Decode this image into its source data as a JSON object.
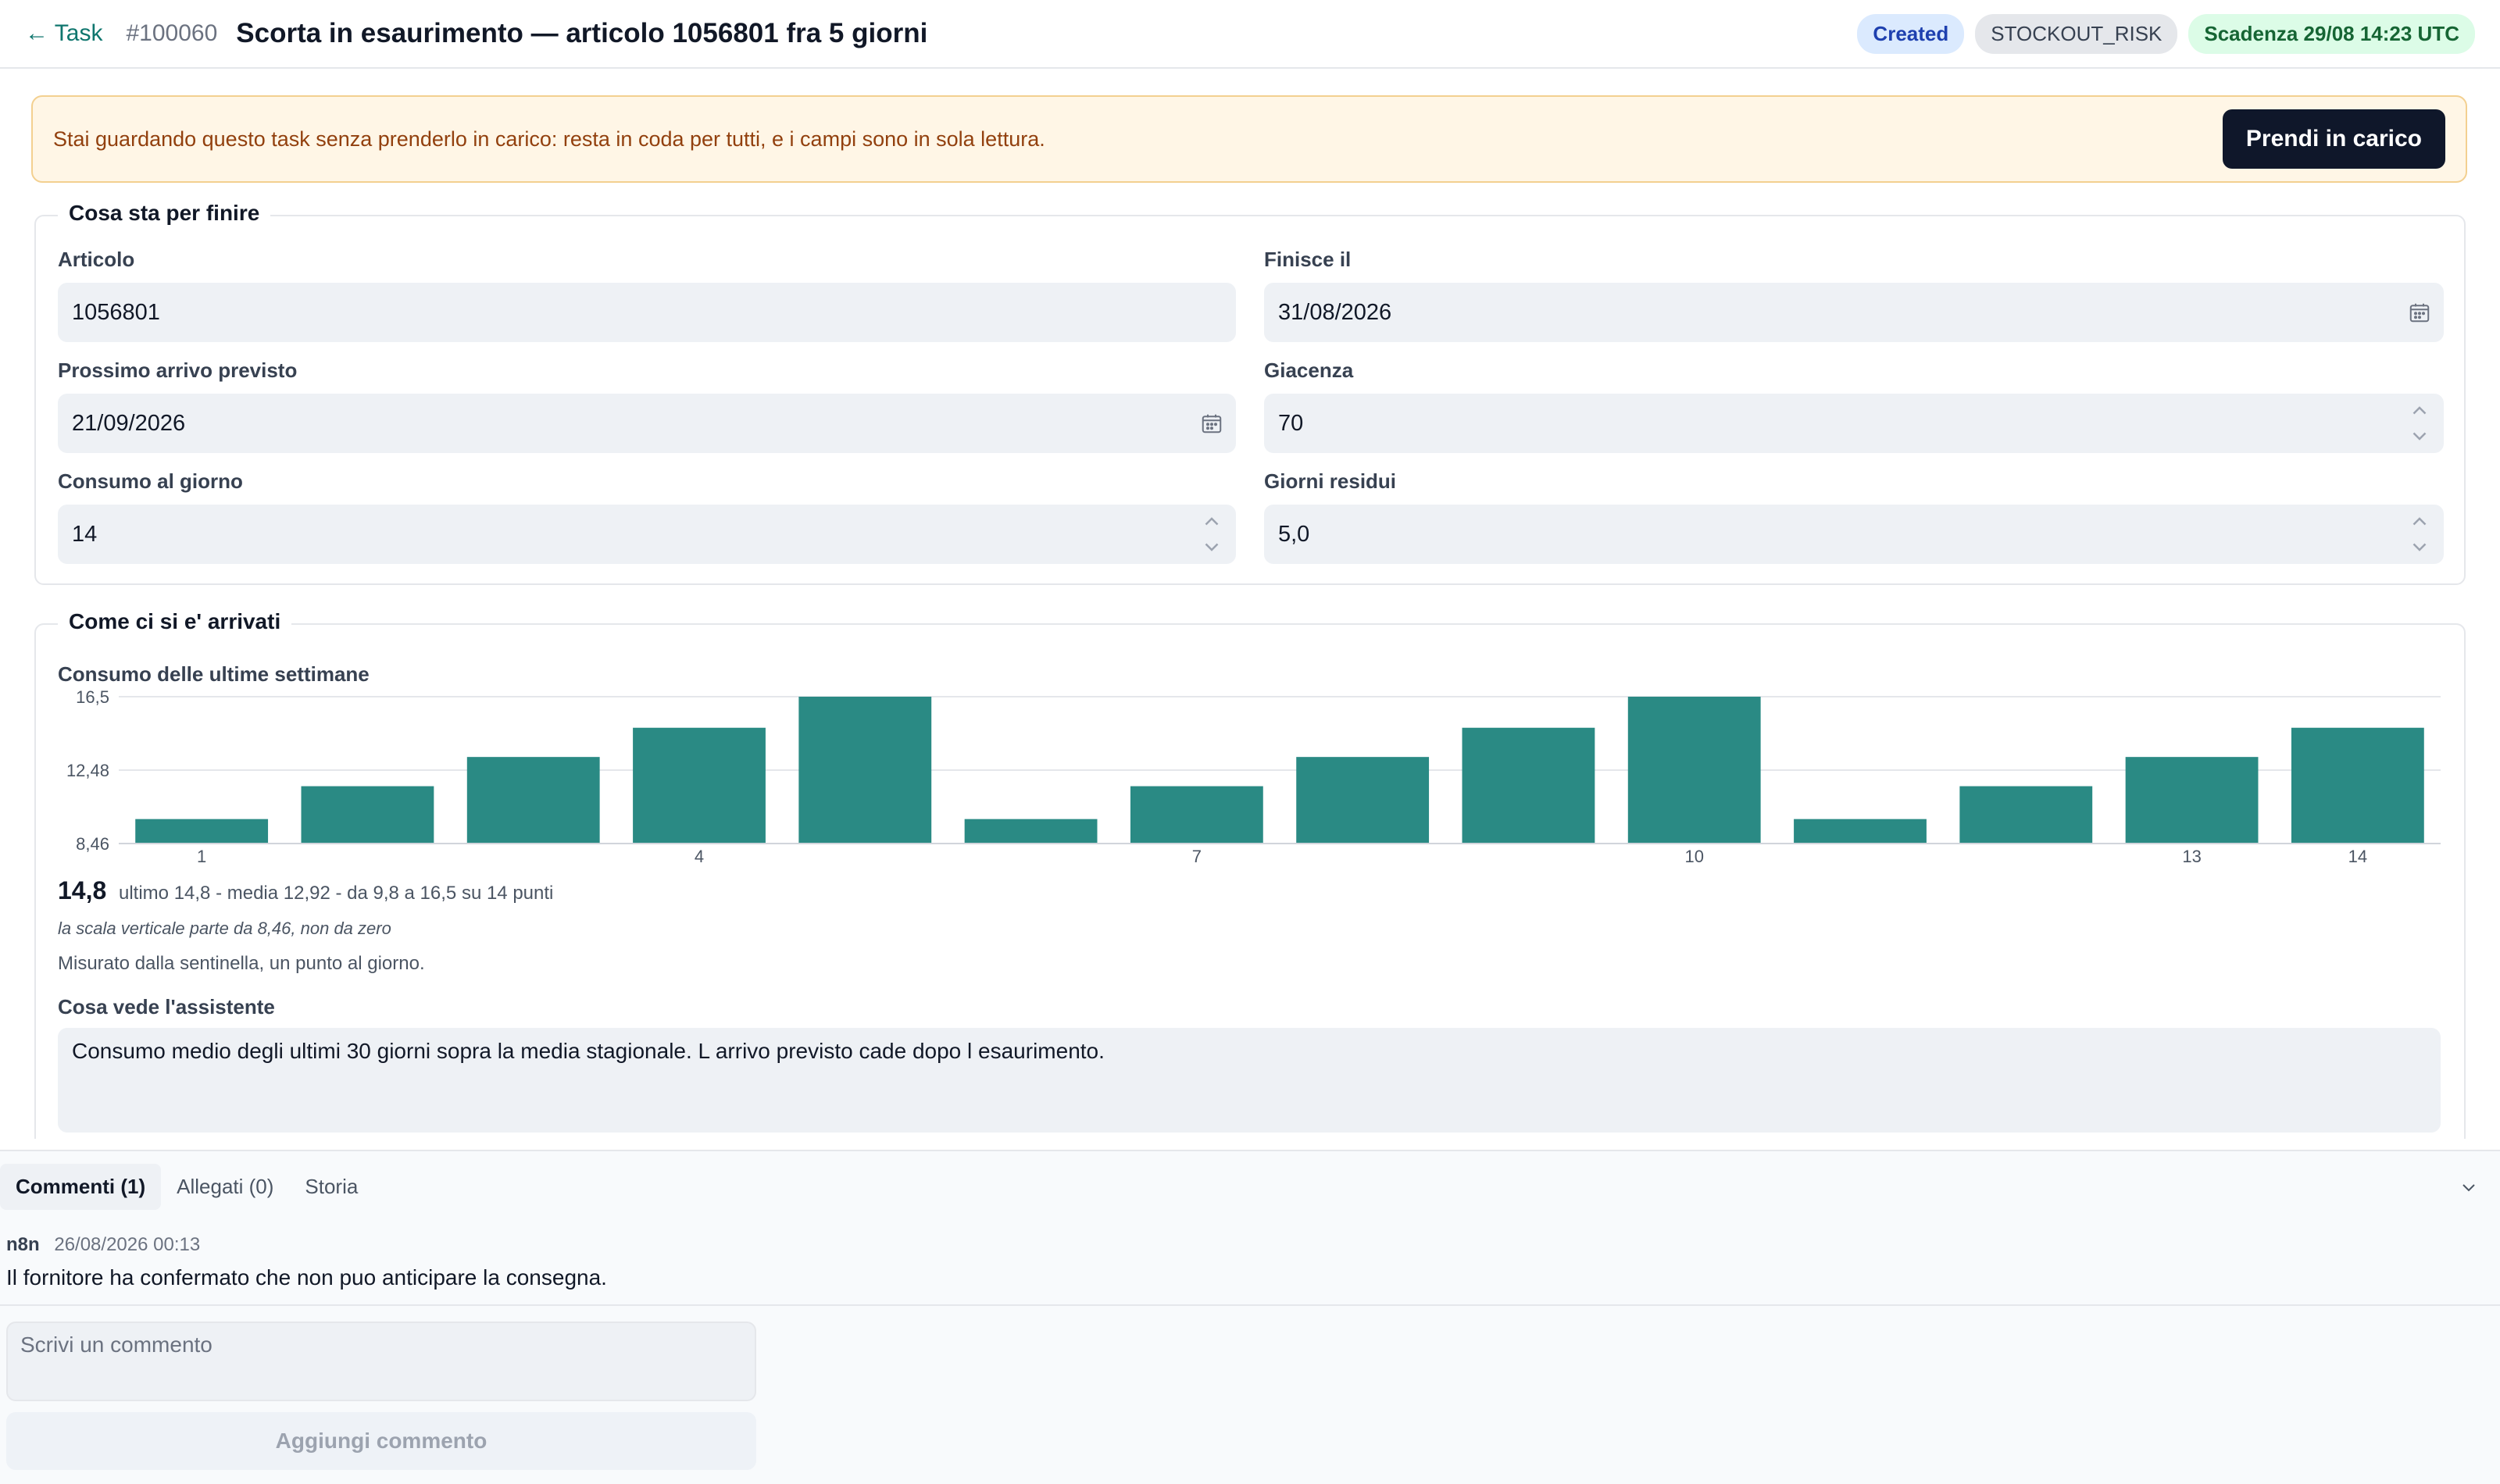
{
  "header": {
    "back_label": "← Task",
    "task_id": "#100060",
    "title": "Scorta in esaurimento — articolo 1056801 fra 5 giorni",
    "badges": {
      "status": "Created",
      "type": "STOCKOUT_RISK",
      "due": "Scadenza 29/08 14:23 UTC"
    }
  },
  "banner": {
    "text": "Stai guardando questo task senza prenderlo in carico: resta in coda per tutti, e i campi sono in sola lettura.",
    "button_label": "Prendi in carico"
  },
  "section_what": {
    "title": "Cosa sta per finire",
    "fields": {
      "articolo": {
        "label": "Articolo",
        "value": "1056801"
      },
      "finisce_il": {
        "label": "Finisce il",
        "value": "31/08/2026"
      },
      "prossimo_arrivo": {
        "label": "Prossimo arrivo previsto",
        "value": "21/09/2026"
      },
      "giacenza": {
        "label": "Giacenza",
        "value": "70"
      },
      "consumo": {
        "label": "Consumo al giorno",
        "value": "14"
      },
      "giorni_residui": {
        "label": "Giorni residui",
        "value": "5,0"
      }
    }
  },
  "section_how": {
    "title": "Come ci si e' arrivati",
    "chart_label": "Consumo delle ultime settimane",
    "big_value": "14,8",
    "stats": "ultimo 14,8 - media 12,92 - da 9,8 a 16,5 su 14 punti",
    "scale_note": "la scala verticale parte da 8,46, non da zero",
    "measure_note": "Misurato dalla sentinella, un punto al giorno.",
    "assistant_label": "Cosa vede l'assistente",
    "assistant_text": "Consumo medio degli ultimi 30 giorni sopra la media stagionale. L arrivo previsto cade dopo l esaurimento."
  },
  "chart_data": {
    "type": "bar",
    "categories": [
      1,
      2,
      3,
      4,
      5,
      6,
      7,
      8,
      9,
      10,
      11,
      12,
      13,
      14
    ],
    "values": [
      9.8,
      11.6,
      13.2,
      14.8,
      16.5,
      9.8,
      11.6,
      13.2,
      14.8,
      16.5,
      9.8,
      11.6,
      13.2,
      14.8
    ],
    "x_tick_labels": [
      "1",
      "4",
      "7",
      "10",
      "13",
      "14"
    ],
    "x_tick_positions": [
      1,
      4,
      7,
      10,
      13,
      14
    ],
    "y_tick_labels": [
      "16,5",
      "12,48",
      "8,46"
    ],
    "ylim": [
      8.46,
      16.5
    ],
    "grid": true,
    "bar_color": "#2a8a84"
  },
  "comments_panel": {
    "tabs": [
      "Commenti (1)",
      "Allegati (0)",
      "Storia"
    ],
    "comment": {
      "author": "n8n",
      "date": "26/08/2026 00:13",
      "text": "Il fornitore ha confermato che non puo anticipare la consegna."
    },
    "input_placeholder": "Scrivi un commento",
    "add_button_label": "Aggiungi commento"
  }
}
